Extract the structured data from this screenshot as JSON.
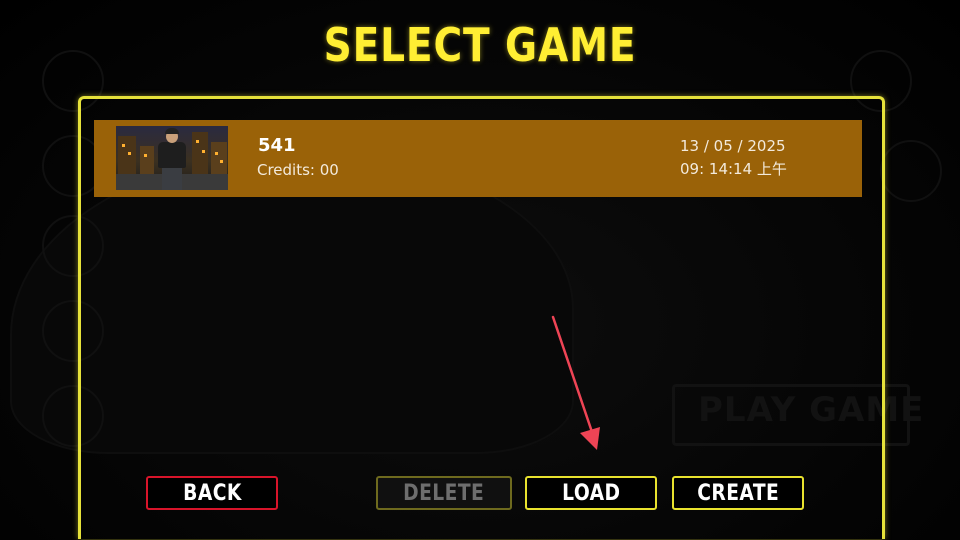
{
  "header": {
    "title": "SELECT GAME"
  },
  "save_slots": [
    {
      "name": "541",
      "credits": "Credits: 00",
      "date": "13 / 05 / 2025",
      "time": "09: 14:14 上午",
      "selected": true,
      "thumbnail_icon": "character-city-night-thumbnail"
    }
  ],
  "buttons": {
    "back": "BACK",
    "delete": "DELETE",
    "load": "LOAD",
    "create": "CREATE"
  },
  "background": {
    "faded_label": "PLAY GAME"
  },
  "colors": {
    "accent_yellow": "#ffee33",
    "row_highlight": "#9a6208",
    "back_border": "#d8142a",
    "annotation_arrow": "#ee4455"
  }
}
